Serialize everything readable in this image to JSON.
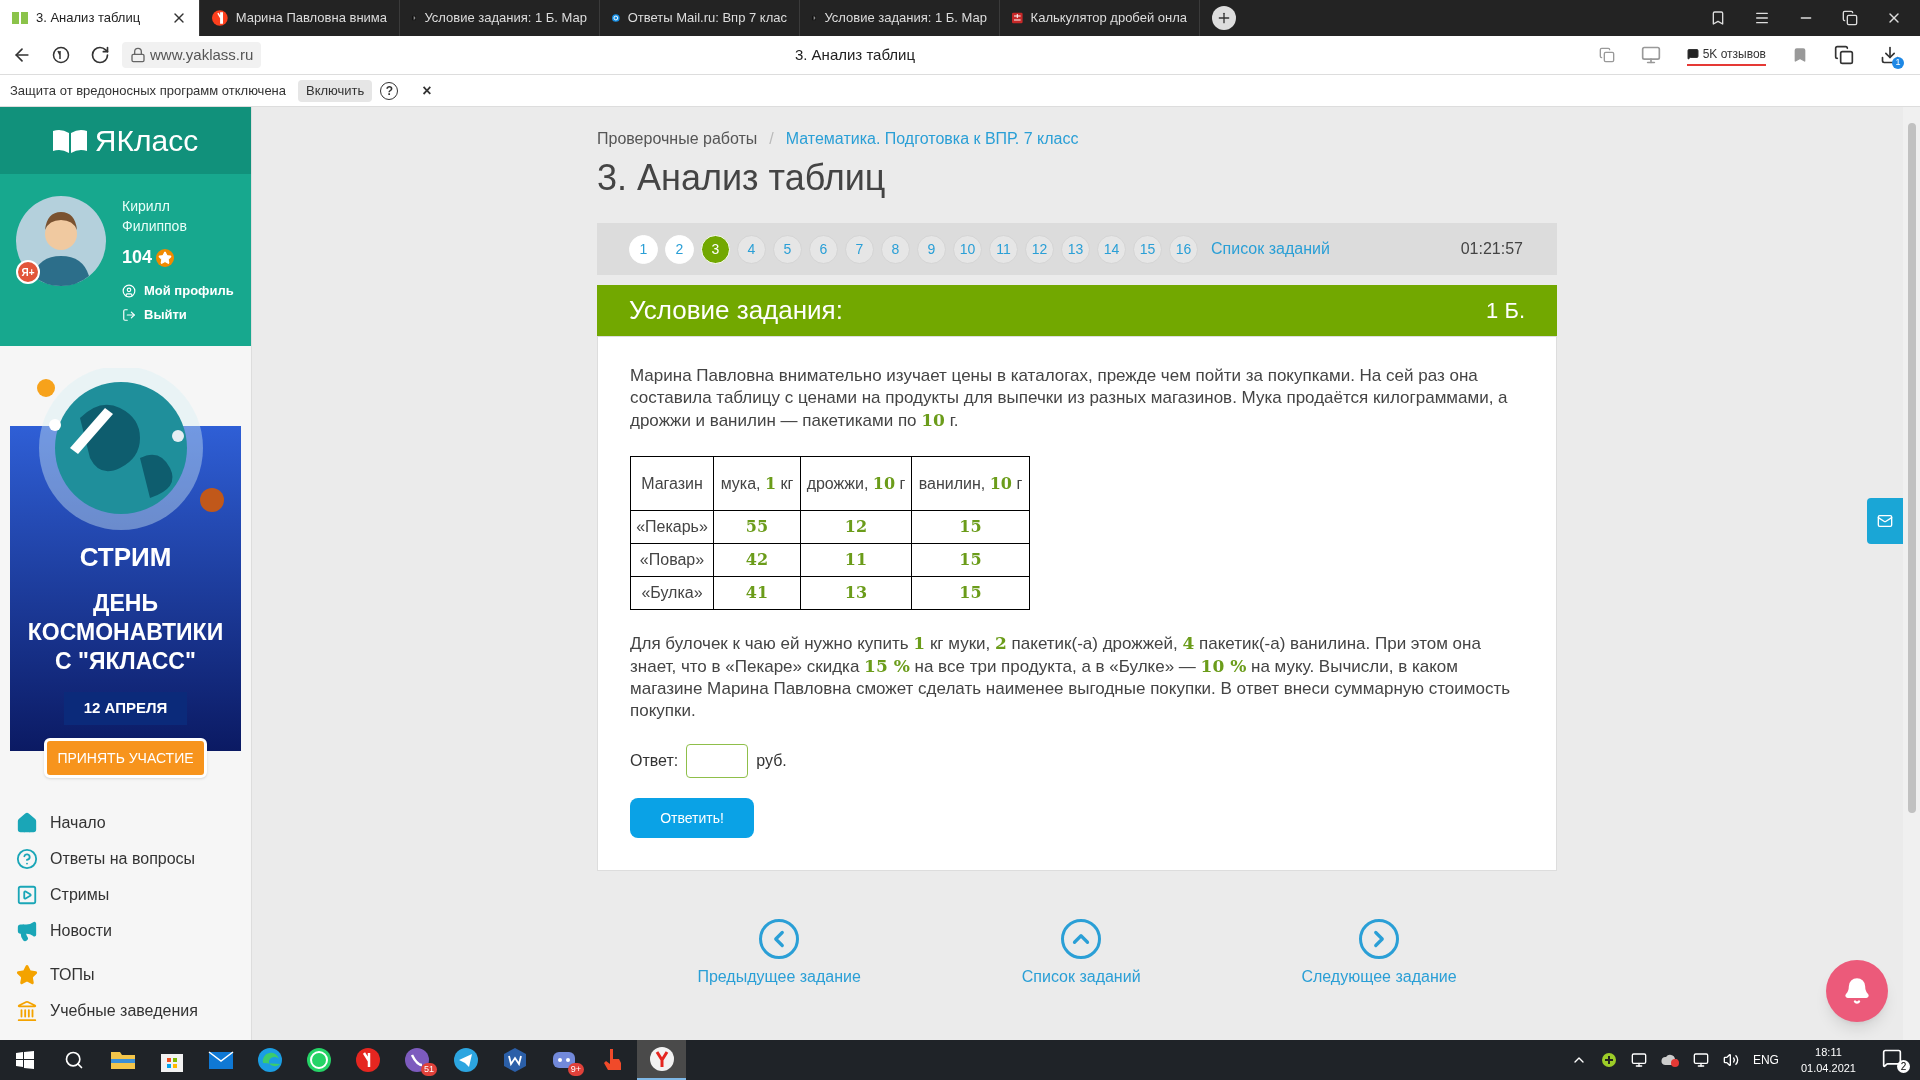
{
  "browser": {
    "tabs": [
      {
        "title": "3. Анализ таблиц",
        "kind": "yaklass",
        "selected": true
      },
      {
        "title": "Марина Павловна внима",
        "kind": "yandex",
        "selected": false
      },
      {
        "title": "Условие задания: 1 Б. Мар",
        "kind": "z",
        "selected": false
      },
      {
        "title": "Ответы Mail.ru: Впр 7 клас",
        "kind": "mail",
        "selected": false
      },
      {
        "title": "Условие задания: 1 Б. Мар",
        "kind": "z",
        "selected": false
      },
      {
        "title": "Калькулятор дробей онла",
        "kind": "calc",
        "selected": false
      }
    ],
    "url": "www.yaklass.ru",
    "page_title": "3. Анализ таблиц",
    "reviews": "5K отзывов",
    "downloads": "1"
  },
  "infobar": {
    "message": "Защита от вредоносных программ отключена",
    "button": "Включить",
    "help": "?",
    "close": "×"
  },
  "sidebar": {
    "logo": "ЯКласс",
    "user": {
      "first_name": "Кирилл",
      "last_name": "Филиппов",
      "points": "104",
      "badge": "Я+",
      "links": [
        {
          "label": "Мой профиль",
          "kind": "profile"
        },
        {
          "label": "Выйти",
          "kind": "logout"
        }
      ]
    },
    "banner": {
      "title": "СТРИМ",
      "subtitle": "ДЕНЬ КОСМОНАВТИКИ С \"ЯКЛАСС\"",
      "date": "12 АПРЕЛЯ",
      "button": "ПРИНЯТЬ УЧАСТИЕ"
    },
    "nav_groups": [
      [
        {
          "label": "Начало",
          "kind": "home"
        },
        {
          "label": "Ответы на вопросы",
          "kind": "help"
        },
        {
          "label": "Стримы",
          "kind": "stream"
        },
        {
          "label": "Новости",
          "kind": "news"
        }
      ],
      [
        {
          "label": "ТОПы",
          "kind": "tops"
        },
        {
          "label": "Учебные заведения",
          "kind": "schools"
        }
      ]
    ]
  },
  "breadcrumb_separator": "/",
  "breadcrumbs": [
    {
      "label": "Проверочные работы",
      "link": false
    },
    {
      "label": "Математика. Подготовка к ВПР. 7 класс",
      "link": true
    }
  ],
  "title": "3. Анализ таблиц",
  "pagination": {
    "pages": [
      {
        "label": "1",
        "selected": false,
        "visited": true
      },
      {
        "label": "2",
        "selected": false,
        "visited": true
      },
      {
        "label": "3",
        "selected": true,
        "visited": true
      },
      {
        "label": "4",
        "selected": false,
        "visited": false
      },
      {
        "label": "5",
        "selected": false,
        "visited": false
      },
      {
        "label": "6",
        "selected": false,
        "visited": false
      },
      {
        "label": "7",
        "selected": false,
        "visited": false
      },
      {
        "label": "8",
        "selected": false,
        "visited": false
      },
      {
        "label": "9",
        "selected": false,
        "visited": false
      },
      {
        "label": "10",
        "selected": false,
        "visited": false
      },
      {
        "label": "11",
        "selected": false,
        "visited": false
      },
      {
        "label": "12",
        "selected": false,
        "visited": false
      },
      {
        "label": "13",
        "selected": false,
        "visited": false
      },
      {
        "label": "14",
        "selected": false,
        "visited": false
      },
      {
        "label": "15",
        "selected": false,
        "visited": false
      },
      {
        "label": "16",
        "selected": false,
        "visited": false
      }
    ],
    "list_link": "Список заданий",
    "timer": "01:21:57"
  },
  "task": {
    "heading": "Условие задания:",
    "points": "1 Б.",
    "intro": "Марина Павловна внимательно изучает цены в каталогах, прежде чем пойти за покупками. На сей раз она составила таблицу с ценами на продукты для выпечки из разных магазинов. Мука продаётся килограммами, а дрожжи и ванилин — пакетиками по **10** г.",
    "table": {
      "columns": [
        "Магазин",
        "мука, **1** кг",
        "дрожжи, **10** г",
        "ванилин, **10** г"
      ],
      "rows": [
        [
          "«Пекарь»",
          "55",
          "12",
          "15"
        ],
        [
          "«Повар»",
          "42",
          "11",
          "15"
        ],
        [
          "«Булка»",
          "41",
          "13",
          "15"
        ]
      ]
    },
    "question": "Для булочек к чаю ей нужно купить **1** кг муки, **2** пакетик(-а) дрожжей, **4** пакетик(-а) ванилина. При этом она знает, что в «Пекаре» скидка **15 %** на все три продукта, а в «Булке» — **10 %** на муку. Вычисли, в каком магазине Марина Павловна сможет сделать наименее выгодные покупки. В ответ внеси суммарную стоимость покупки.",
    "answer_label": "Ответ:",
    "unit": "руб.",
    "submit": "Ответить!"
  },
  "bottom_nav": [
    {
      "label": "Предыдущее задание",
      "kind": "prev"
    },
    {
      "label": "Список заданий",
      "kind": "list"
    },
    {
      "label": "Следующее задание",
      "kind": "next"
    }
  ],
  "taskbar": {
    "apps": [
      {
        "kind": "explorer",
        "selected": false
      },
      {
        "kind": "store",
        "selected": false
      },
      {
        "kind": "mail",
        "selected": false
      },
      {
        "kind": "edge",
        "selected": false
      },
      {
        "kind": "whatsapp",
        "selected": false
      },
      {
        "kind": "yandex",
        "selected": false
      },
      {
        "kind": "viber",
        "selected": false,
        "badge": "51"
      },
      {
        "kind": "telegram",
        "selected": false
      },
      {
        "kind": "wclient",
        "selected": false
      },
      {
        "kind": "discord",
        "selected": false,
        "badge": "9+"
      },
      {
        "kind": "hand",
        "selected": false
      },
      {
        "kind": "ybrowser",
        "selected": true
      }
    ],
    "language": "ENG",
    "time": "18:11",
    "date": "01.04.2021",
    "notifications": "2"
  }
}
